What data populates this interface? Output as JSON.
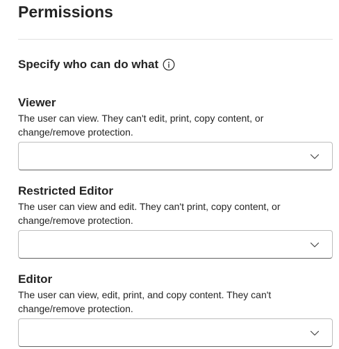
{
  "page_title": "Permissions",
  "section": {
    "heading": "Specify who can do what"
  },
  "roles": [
    {
      "title": "Viewer",
      "description": "The user can view. They can't edit, print, copy content, or change/remove protection.",
      "selected_value": ""
    },
    {
      "title": "Restricted Editor",
      "description": "The user can view and edit. They can't print, copy content, or change/remove protection.",
      "selected_value": ""
    },
    {
      "title": "Editor",
      "description": "The user can view, edit, print, and copy content. They can't change/remove protection.",
      "selected_value": ""
    }
  ],
  "icons": {
    "info": "info-icon",
    "dropdown": "chevron-down-icon"
  },
  "colors": {
    "text": "#242424",
    "border": "#bdbdbd",
    "divider": "#e1e1e1"
  }
}
